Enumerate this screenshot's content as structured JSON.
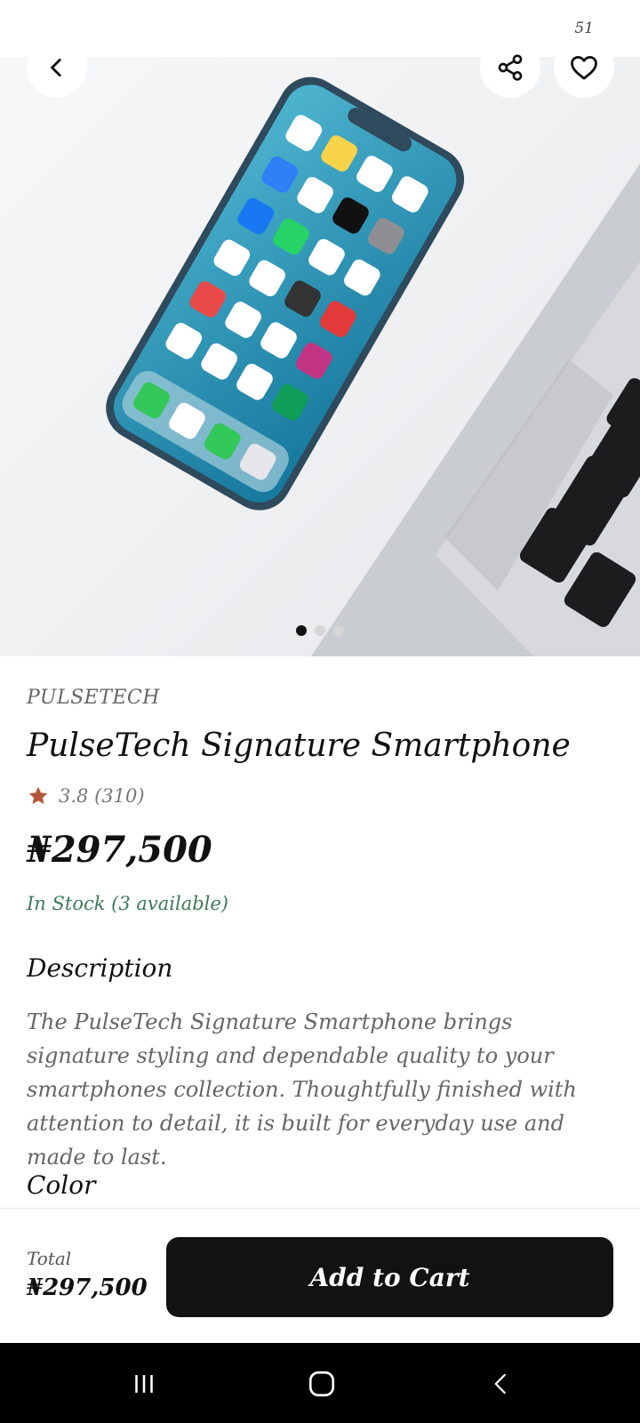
{
  "status_bar": {
    "text": "51"
  },
  "gallery": {
    "image_count": 3,
    "active_index": 0
  },
  "product": {
    "brand": "PULSETECH",
    "name": "PulseTech Signature Smartphone",
    "rating_text": "3.8 (310)",
    "price": "₦297,500",
    "stock": "In Stock (3 available)"
  },
  "description": {
    "heading": "Description",
    "text": "The PulseTech Signature Smartphone brings signature styling and dependable quality to your smartphones collection. Thoughtfully finished with attention to detail, it is built for everyday use and made to last."
  },
  "color_section": {
    "heading": "Color"
  },
  "footer": {
    "total_label": "Total",
    "total_value": "₦297,500",
    "cart_label": "Add to Cart"
  },
  "colors": {
    "accent": "#121212",
    "stock_green": "#3c7a58",
    "star": "#b5563a"
  },
  "icons": [
    "back-arrow-icon",
    "share-icon",
    "heart-icon",
    "star-icon",
    "recents-icon",
    "home-icon",
    "nav-back-icon"
  ]
}
